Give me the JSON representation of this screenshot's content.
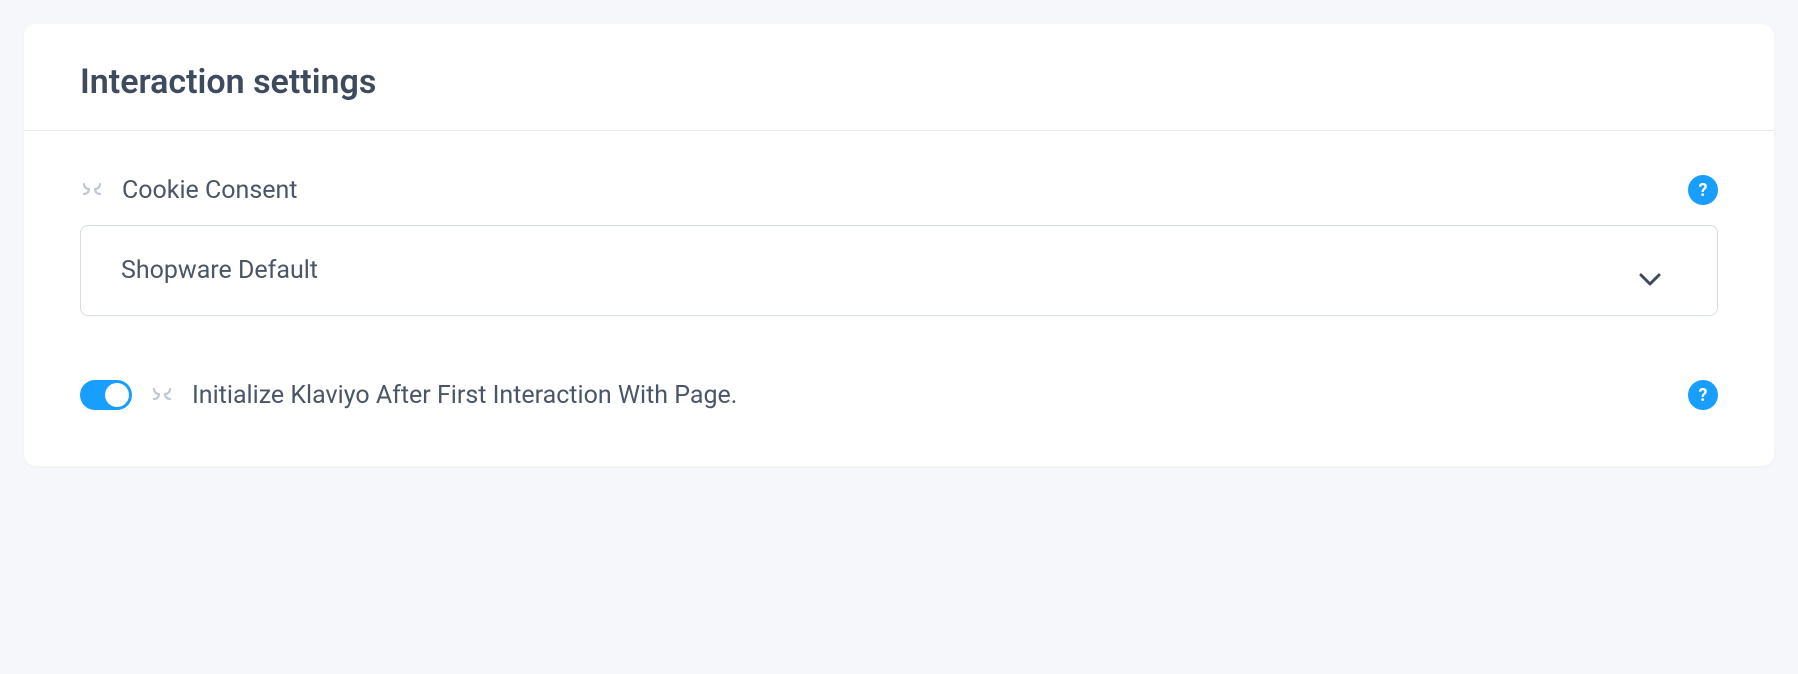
{
  "section": {
    "title": "Interaction settings"
  },
  "cookieConsent": {
    "label": "Cookie Consent",
    "selected": "Shopware Default"
  },
  "initKlaviyo": {
    "label": "Initialize Klaviyo After First Interaction With Page.",
    "enabled": true
  },
  "help": {
    "glyph": "?"
  }
}
